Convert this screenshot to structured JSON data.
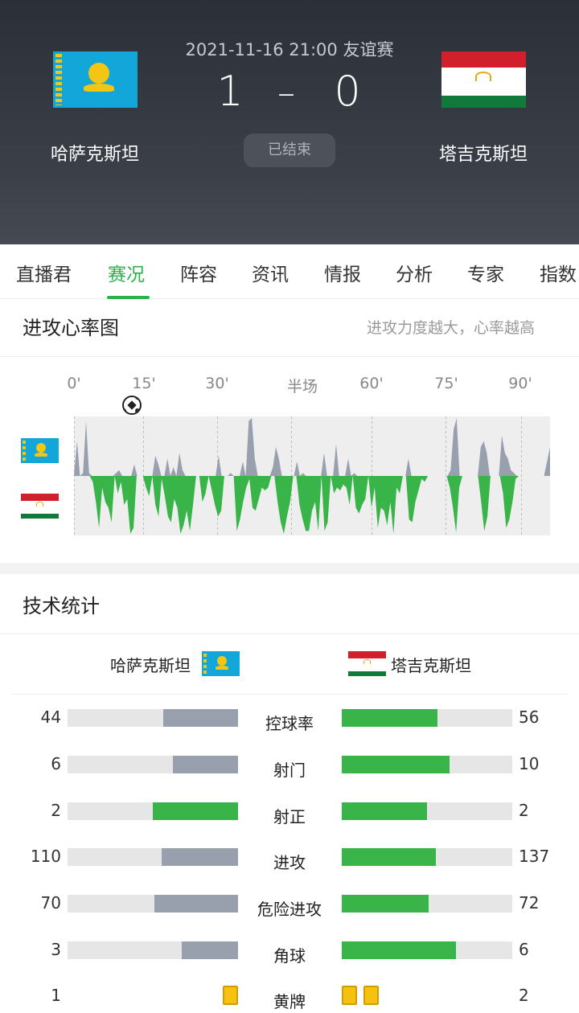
{
  "match": {
    "datetime_type": "2021-11-16 21:00 友谊赛",
    "home_score": "1",
    "away_score": "0",
    "dash": "–",
    "status": "已结束",
    "home_team": "哈萨克斯坦",
    "away_team": "塔吉克斯坦"
  },
  "tabs": [
    "直播君",
    "赛况",
    "阵容",
    "资讯",
    "情报",
    "分析",
    "专家",
    "指数"
  ],
  "active_tab": 1,
  "attack_chart": {
    "title": "进攻心率图",
    "note": "进攻力度越大，心率越高",
    "minute_labels": [
      "0'",
      "15'",
      "30'",
      "半场",
      "60'",
      "75'",
      "90'"
    ],
    "home_color": "#98a0ae",
    "away_color": "#38b449",
    "goal_icon": "football-icon",
    "home_series": [
      0,
      0.6,
      0,
      0.05,
      0.95,
      0.05,
      0,
      0,
      0,
      0,
      0,
      0,
      0,
      0,
      0.05,
      0.1,
      0,
      0,
      0,
      0,
      0.2,
      0,
      0,
      0,
      0,
      0,
      0,
      0.35,
      0.2,
      0,
      0,
      0.3,
      0,
      0.15,
      0,
      0.4,
      0.1,
      0,
      0,
      0,
      0,
      0,
      0,
      0,
      0,
      0,
      0,
      0,
      0.35,
      0,
      0,
      0,
      0.05,
      0,
      0,
      0,
      0.25,
      0,
      0.95,
      1,
      0.3,
      0,
      0,
      0,
      0,
      0,
      0.15,
      0.5,
      0.3,
      0,
      0,
      0,
      0,
      0,
      0.25,
      0,
      0.05,
      0,
      0,
      0,
      0,
      0,
      0,
      0.4,
      0,
      0,
      0,
      0.55,
      0,
      0,
      0,
      0.3,
      0,
      0.05,
      0,
      0,
      0,
      0,
      0,
      0,
      0,
      0,
      0,
      0,
      0,
      0,
      0,
      0,
      0,
      0,
      0,
      0.3,
      0,
      0,
      0,
      0,
      0,
      0,
      0,
      0,
      0,
      0,
      0,
      0,
      0,
      0.1,
      0.8,
      1,
      0,
      0,
      0,
      0,
      0,
      0,
      0,
      0.5,
      0.6,
      0.4,
      0,
      0,
      0,
      0,
      0.7,
      0.4,
      0.3,
      0.1,
      0.05,
      0,
      0,
      0,
      0,
      0,
      0,
      0,
      0,
      0,
      0,
      0.25,
      0.5
    ],
    "away_series": [
      0,
      0,
      0,
      0,
      0,
      0,
      0.1,
      0.45,
      0.9,
      0.2,
      0.45,
      0.55,
      0.8,
      0,
      0.3,
      0.1,
      0.5,
      0.4,
      1,
      0.9,
      0,
      0,
      0,
      0.2,
      0.35,
      0,
      0.5,
      0.7,
      0.05,
      0.35,
      0.7,
      0.8,
      0.4,
      0.55,
      1,
      0.85,
      0.6,
      0.95,
      0.5,
      0,
      0,
      0.45,
      0.3,
      0,
      0.25,
      0.5,
      0.7,
      0.6,
      0,
      0,
      0,
      0,
      0.95,
      0.75,
      0.45,
      0.2,
      0.05,
      0.55,
      0.6,
      0.4,
      0.2,
      0.25,
      0.2,
      0,
      0,
      0.45,
      0.8,
      1,
      0.7,
      0.45,
      0,
      0,
      0.5,
      0.75,
      0.95,
      0.95,
      0.6,
      0.45,
      0.95,
      0,
      0.95,
      0.8,
      0,
      0.3,
      0.2,
      0.25,
      0.15,
      0.2,
      0.5,
      0,
      0.55,
      0.65,
      0.5,
      0.4,
      0,
      0.55,
      0.2,
      0.9,
      0.55,
      0.6,
      0.85,
      0.45,
      1,
      0.2,
      0.3,
      0,
      0,
      0.75,
      0.8,
      0.45,
      0.25,
      0.05,
      0.1,
      0,
      0,
      0,
      0,
      0,
      0,
      0,
      0.2,
      0.55,
      0.98,
      0.2,
      0,
      0,
      0,
      0,
      0,
      0,
      0.45,
      0.95,
      0.7,
      0,
      0,
      0,
      0,
      0.3,
      0.9,
      0.75,
      0.45,
      0.05,
      0,
      0,
      0,
      0,
      0,
      0,
      0,
      0,
      0,
      0,
      0
    ]
  },
  "stats": {
    "title": "技术统计",
    "home_team": "哈萨克斯坦",
    "away_team": "塔吉克斯坦",
    "rows": [
      {
        "label": "控球率",
        "home": "44",
        "away": "56",
        "home_frac": 0.44,
        "away_frac": 0.56,
        "home_color": "#98a0ae",
        "away_color": "#38b449"
      },
      {
        "label": "射门",
        "home": "6",
        "away": "10",
        "home_frac": 0.38,
        "away_frac": 0.63,
        "home_color": "#98a0ae",
        "away_color": "#38b449"
      },
      {
        "label": "射正",
        "home": "2",
        "away": "2",
        "home_frac": 0.5,
        "away_frac": 0.5,
        "home_color": "#38b449",
        "away_color": "#38b449"
      },
      {
        "label": "进攻",
        "home": "110",
        "away": "137",
        "home_frac": 0.45,
        "away_frac": 0.55,
        "home_color": "#98a0ae",
        "away_color": "#38b449"
      },
      {
        "label": "危险进攻",
        "home": "70",
        "away": "72",
        "home_frac": 0.49,
        "away_frac": 0.51,
        "home_color": "#98a0ae",
        "away_color": "#38b449"
      },
      {
        "label": "角球",
        "home": "3",
        "away": "6",
        "home_frac": 0.33,
        "away_frac": 0.67,
        "home_color": "#98a0ae",
        "away_color": "#38b449"
      }
    ],
    "yellow_cards": {
      "label": "黄牌",
      "home": "1",
      "away": "2",
      "home_count": 1,
      "away_count": 2
    }
  }
}
